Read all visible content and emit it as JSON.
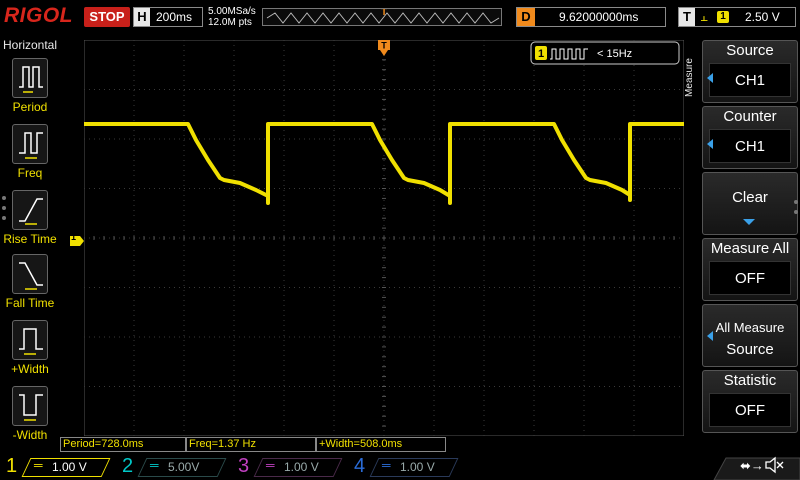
{
  "topbar": {
    "logo": "RIGOL",
    "run_state": "STOP",
    "horizontal_label": "H",
    "timebase": "200ms",
    "sample_rate": "5.00MSa/s",
    "memory_depth": "12.0M pts",
    "trigger_marker": "T",
    "delay_label": "D",
    "delay_value": "9.62000000ms",
    "trigger_label": "T",
    "trigger_source": "1",
    "trigger_level": "2.50 V"
  },
  "left_menu": {
    "title": "Horizontal",
    "items": [
      {
        "label": "Period",
        "icon": "period-icon"
      },
      {
        "label": "Freq",
        "icon": "freq-icon"
      },
      {
        "label": "Rise Time",
        "icon": "rise-time-icon"
      },
      {
        "label": "Fall Time",
        "icon": "fall-time-icon"
      },
      {
        "label": "+Width",
        "icon": "pos-width-icon"
      },
      {
        "label": "-Width",
        "icon": "neg-width-icon"
      }
    ]
  },
  "screen": {
    "freq_badge_channel": "1",
    "freq_badge_text": "< 15Hz",
    "ch1_marker": "1",
    "trigger_position_marker": "T"
  },
  "right_menu": {
    "tab_label": "Measure",
    "items": [
      {
        "title": "Source",
        "value": "CH1"
      },
      {
        "title": "Counter",
        "value": "CH1"
      },
      {
        "title": "Clear"
      },
      {
        "title": "Measure All",
        "value": "OFF"
      },
      {
        "line1": "All Measure",
        "line2": "Source"
      },
      {
        "title": "Statistic",
        "value": "OFF"
      }
    ]
  },
  "measurements": [
    {
      "text": "Period=728.0ms"
    },
    {
      "text": "Freq=1.37 Hz"
    },
    {
      "text": "+Width=508.0ms"
    }
  ],
  "channels": [
    {
      "num": "1",
      "scale": "1.00 V",
      "color": "#f0e000"
    },
    {
      "num": "2",
      "scale": "5.00V",
      "color": "#00c8c8"
    },
    {
      "num": "3",
      "scale": "1.00 V",
      "color": "#c040c0"
    },
    {
      "num": "4",
      "scale": "1.00 V",
      "color": "#2a6cd8"
    }
  ],
  "colors": {
    "ch1_trace": "#f0e000",
    "brand_red": "#d8261c",
    "trigger_orange": "#f08a1c",
    "menu_accent": "#3aa0e8",
    "grid": "#3a3a3a"
  }
}
